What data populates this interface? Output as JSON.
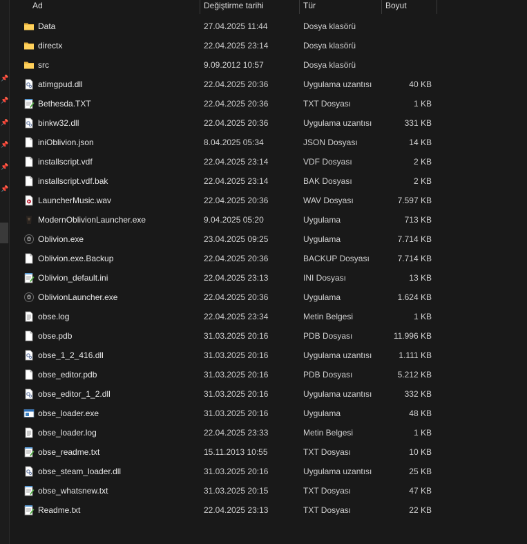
{
  "columns": {
    "name": "Ad",
    "date": "Değiştirme tarihi",
    "type": "Tür",
    "size": "Boyut"
  },
  "files": [
    {
      "name": "Data",
      "date": "27.04.2025 11:44",
      "type": "Dosya klasörü",
      "size": "",
      "icon": "folder-icon"
    },
    {
      "name": "directx",
      "date": "22.04.2025 23:14",
      "type": "Dosya klasörü",
      "size": "",
      "icon": "folder-icon"
    },
    {
      "name": "src",
      "date": "9.09.2012 10:57",
      "type": "Dosya klasörü",
      "size": "",
      "icon": "folder-icon"
    },
    {
      "name": "atimgpud.dll",
      "date": "22.04.2025 20:36",
      "type": "Uygulama uzantısı",
      "size": "40 KB",
      "icon": "dll-icon"
    },
    {
      "name": "Bethesda.TXT",
      "date": "22.04.2025 20:36",
      "type": "TXT Dosyası",
      "size": "1 KB",
      "icon": "notepad-icon"
    },
    {
      "name": "binkw32.dll",
      "date": "22.04.2025 20:36",
      "type": "Uygulama uzantısı",
      "size": "331 KB",
      "icon": "dll-icon"
    },
    {
      "name": "iniOblivion.json",
      "date": "8.04.2025 05:34",
      "type": "JSON Dosyası",
      "size": "14 KB",
      "icon": "file-icon"
    },
    {
      "name": "installscript.vdf",
      "date": "22.04.2025 23:14",
      "type": "VDF Dosyası",
      "size": "2 KB",
      "icon": "file-icon"
    },
    {
      "name": "installscript.vdf.bak",
      "date": "22.04.2025 23:14",
      "type": "BAK Dosyası",
      "size": "2 KB",
      "icon": "file-icon"
    },
    {
      "name": "LauncherMusic.wav",
      "date": "22.04.2025 20:36",
      "type": "WAV Dosyası",
      "size": "7.597 KB",
      "icon": "media-icon"
    },
    {
      "name": "ModernOblivionLauncher.exe",
      "date": "9.04.2025 05:20",
      "type": "Uygulama",
      "size": "713 KB",
      "icon": "app-icon"
    },
    {
      "name": "Oblivion.exe",
      "date": "23.04.2025 09:25",
      "type": "Uygulama",
      "size": "7.714 KB",
      "icon": "oblivion-icon"
    },
    {
      "name": "Oblivion.exe.Backup",
      "date": "22.04.2025 20:36",
      "type": "BACKUP Dosyası",
      "size": "7.714 KB",
      "icon": "file-icon"
    },
    {
      "name": "Oblivion_default.ini",
      "date": "22.04.2025 23:13",
      "type": "INI Dosyası",
      "size": "13 KB",
      "icon": "notepad-icon"
    },
    {
      "name": "OblivionLauncher.exe",
      "date": "22.04.2025 20:36",
      "type": "Uygulama",
      "size": "1.624 KB",
      "icon": "oblivion-icon"
    },
    {
      "name": "obse.log",
      "date": "22.04.2025 23:34",
      "type": "Metin Belgesi",
      "size": "1 KB",
      "icon": "text-icon"
    },
    {
      "name": "obse.pdb",
      "date": "31.03.2025 20:16",
      "type": "PDB Dosyası",
      "size": "11.996 KB",
      "icon": "file-icon"
    },
    {
      "name": "obse_1_2_416.dll",
      "date": "31.03.2025 20:16",
      "type": "Uygulama uzantısı",
      "size": "1.111 KB",
      "icon": "dll-icon"
    },
    {
      "name": "obse_editor.pdb",
      "date": "31.03.2025 20:16",
      "type": "PDB Dosyası",
      "size": "5.212 KB",
      "icon": "file-icon"
    },
    {
      "name": "obse_editor_1_2.dll",
      "date": "31.03.2025 20:16",
      "type": "Uygulama uzantısı",
      "size": "332 KB",
      "icon": "dll-icon"
    },
    {
      "name": "obse_loader.exe",
      "date": "31.03.2025 20:16",
      "type": "Uygulama",
      "size": "48 KB",
      "icon": "window-icon"
    },
    {
      "name": "obse_loader.log",
      "date": "22.04.2025 23:33",
      "type": "Metin Belgesi",
      "size": "1 KB",
      "icon": "text-icon"
    },
    {
      "name": "obse_readme.txt",
      "date": "15.11.2013 10:55",
      "type": "TXT Dosyası",
      "size": "10 KB",
      "icon": "notepad-icon"
    },
    {
      "name": "obse_steam_loader.dll",
      "date": "31.03.2025 20:16",
      "type": "Uygulama uzantısı",
      "size": "25 KB",
      "icon": "dll-icon"
    },
    {
      "name": "obse_whatsnew.txt",
      "date": "31.03.2025 20:15",
      "type": "TXT Dosyası",
      "size": "47 KB",
      "icon": "notepad-icon"
    },
    {
      "name": "Readme.txt",
      "date": "22.04.2025 23:13",
      "type": "TXT Dosyası",
      "size": "22 KB",
      "icon": "notepad-icon"
    }
  ]
}
